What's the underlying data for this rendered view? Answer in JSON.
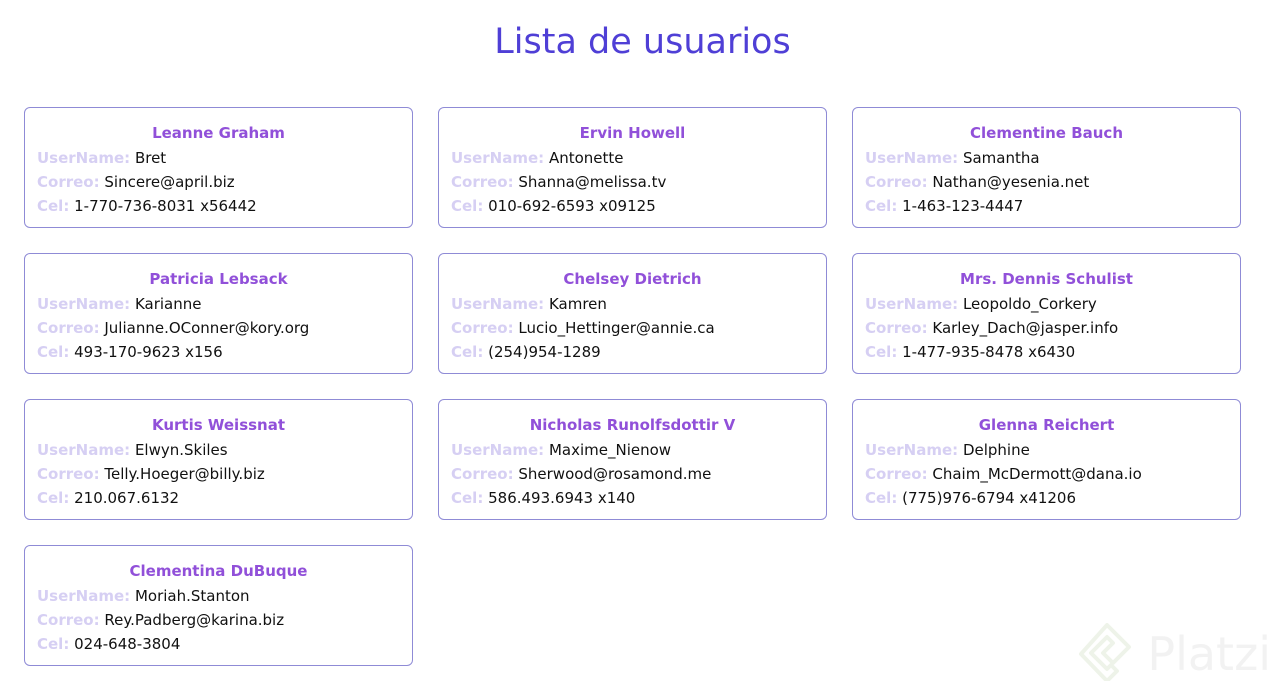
{
  "page": {
    "title": "Lista de usuarios"
  },
  "labels": {
    "username": "UserName:",
    "email": "Correo:",
    "phone": "Cel:"
  },
  "users": [
    {
      "name": "Leanne Graham",
      "username": "Bret",
      "email": "Sincere@april.biz",
      "phone": "1-770-736-8031 x56442"
    },
    {
      "name": "Ervin Howell",
      "username": "Antonette",
      "email": "Shanna@melissa.tv",
      "phone": "010-692-6593 x09125"
    },
    {
      "name": "Clementine Bauch",
      "username": "Samantha",
      "email": "Nathan@yesenia.net",
      "phone": "1-463-123-4447"
    },
    {
      "name": "Patricia Lebsack",
      "username": "Karianne",
      "email": "Julianne.OConner@kory.org",
      "phone": "493-170-9623 x156"
    },
    {
      "name": "Chelsey Dietrich",
      "username": "Kamren",
      "email": "Lucio_Hettinger@annie.ca",
      "phone": "(254)954-1289"
    },
    {
      "name": "Mrs. Dennis Schulist",
      "username": "Leopoldo_Corkery",
      "email": "Karley_Dach@jasper.info",
      "phone": "1-477-935-8478 x6430"
    },
    {
      "name": "Kurtis Weissnat",
      "username": "Elwyn.Skiles",
      "email": "Telly.Hoeger@billy.biz",
      "phone": "210.067.6132"
    },
    {
      "name": "Nicholas Runolfsdottir V",
      "username": "Maxime_Nienow",
      "email": "Sherwood@rosamond.me",
      "phone": "586.493.6943 x140"
    },
    {
      "name": "Glenna Reichert",
      "username": "Delphine",
      "email": "Chaim_McDermott@dana.io",
      "phone": "(775)976-6794 x41206"
    },
    {
      "name": "Clementina DuBuque",
      "username": "Moriah.Stanton",
      "email": "Rey.Padberg@karina.biz",
      "phone": "024-648-3804"
    }
  ],
  "watermark": {
    "text": "Platzi",
    "icon": "platzi-logo-icon"
  },
  "colors": {
    "title": "#4f3fd6",
    "name": "#9150d9",
    "label": "#d6cff3",
    "border": "#8f8bd6"
  }
}
